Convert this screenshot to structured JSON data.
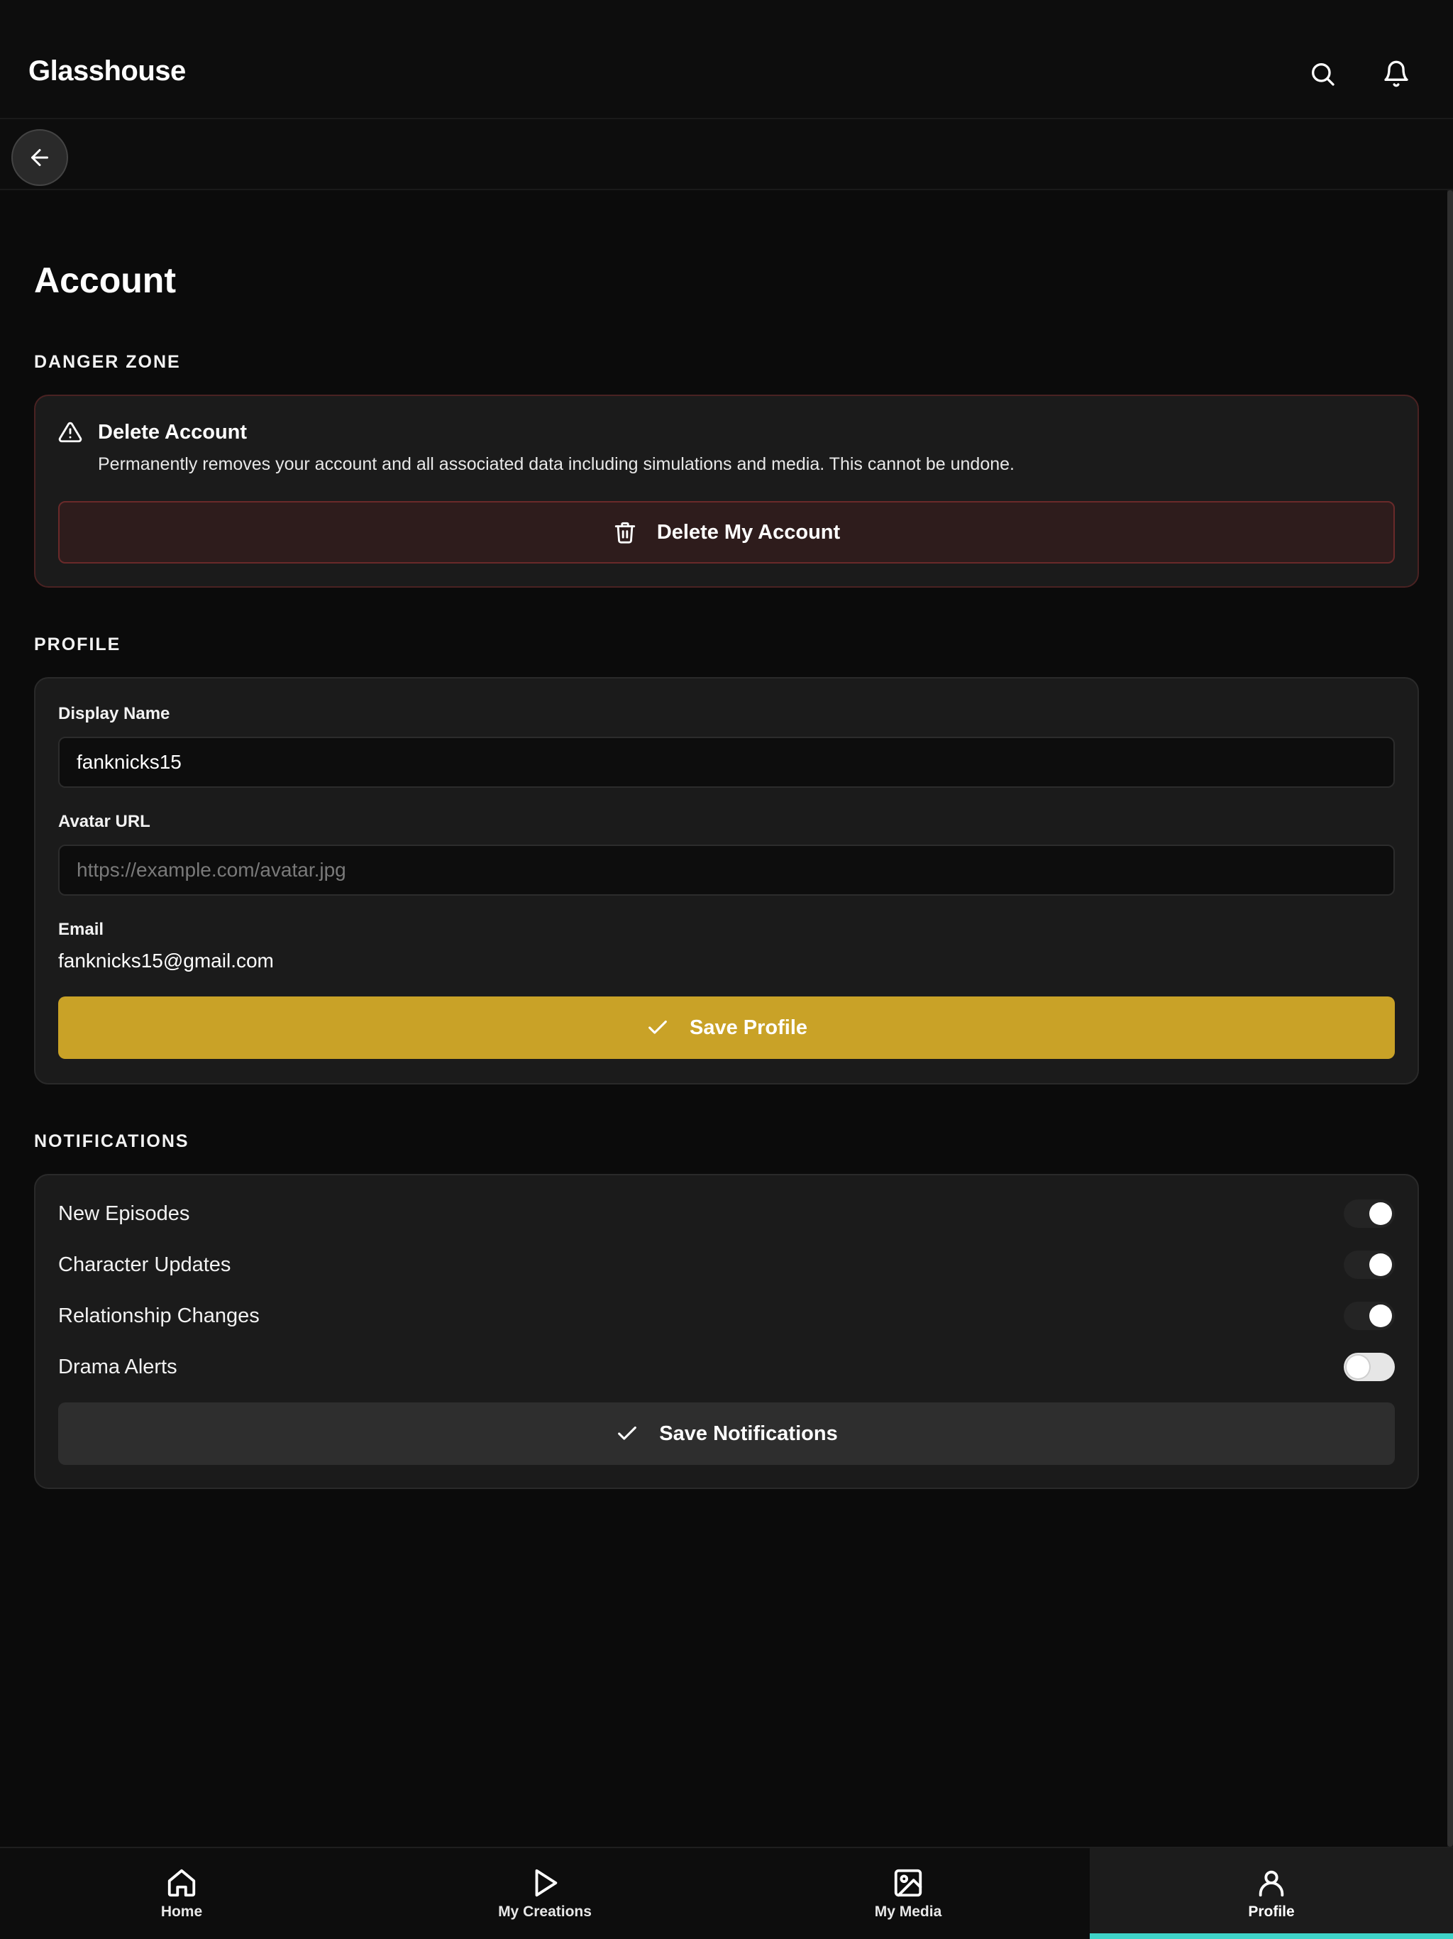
{
  "header": {
    "brand": "Glasshouse",
    "icons": [
      "search-icon",
      "bell-icon"
    ]
  },
  "subheader": {
    "back_icon": "arrow-left-icon"
  },
  "page": {
    "title": "Account"
  },
  "danger_zone": {
    "section_label": "DANGER ZONE",
    "icon": "warning-triangle-icon",
    "title": "Delete Account",
    "description": "Permanently removes your account and all associated data including simulations and media. This cannot be undone.",
    "button_label": "Delete My Account",
    "button_icon": "trash-icon"
  },
  "profile": {
    "section_label": "PROFILE",
    "display_name_label": "Display Name",
    "display_name_value": "fanknicks15",
    "avatar_url_label": "Avatar URL",
    "avatar_url_value": "",
    "avatar_url_placeholder": "https://example.com/avatar.jpg",
    "email_label": "Email",
    "email_value": "fanknicks15@gmail.com",
    "save_label": "Save Profile",
    "save_icon": "check-icon"
  },
  "notifications": {
    "section_label": "NOTIFICATIONS",
    "items": [
      {
        "label": "New Episodes",
        "enabled": true
      },
      {
        "label": "Character Updates",
        "enabled": true
      },
      {
        "label": "Relationship Changes",
        "enabled": true
      },
      {
        "label": "Drama Alerts",
        "enabled": false
      }
    ],
    "save_label": "Save Notifications",
    "save_icon": "check-icon"
  },
  "bottom_nav": {
    "items": [
      {
        "label": "Home",
        "icon": "home-icon",
        "active": false
      },
      {
        "label": "My Creations",
        "icon": "play-icon",
        "active": false
      },
      {
        "label": "My Media",
        "icon": "image-icon",
        "active": false
      },
      {
        "label": "Profile",
        "icon": "user-icon",
        "active": true
      }
    ]
  },
  "colors": {
    "background": "#0b0b0b",
    "card": "#1b1b1b",
    "primary_button": "#c9a227",
    "danger_border": "#6a2a2a",
    "nav_active_indicator": "#3fd3c8"
  }
}
